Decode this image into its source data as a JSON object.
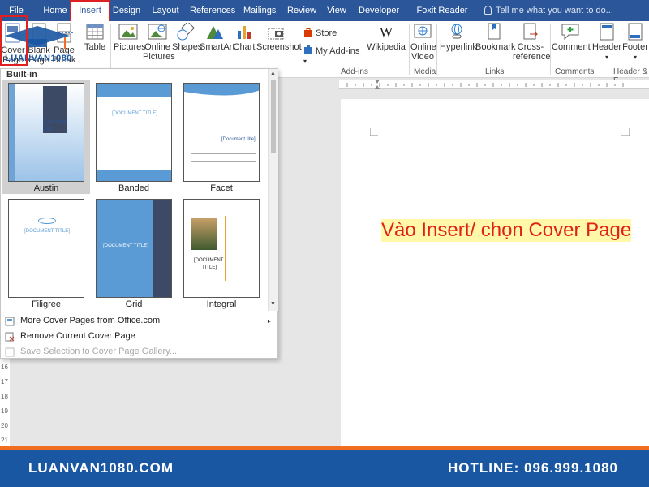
{
  "ribbon_tabs": [
    "File",
    "Home",
    "Insert",
    "Design",
    "Layout",
    "References",
    "Mailings",
    "Review",
    "View",
    "Developer",
    "Foxit Reader PDF"
  ],
  "tell_me": "Tell me what you want to do...",
  "colors": {
    "ribbon": "#2b579a",
    "highlight": "#e02020",
    "footer": "#1a57a2",
    "footer_stripe": "#f26d21",
    "caption_text": "#e0201a",
    "caption_bg": "#fff8a8"
  },
  "ribbon": {
    "pages_group": {
      "cover_page": "Cover Page",
      "blank_page": "Blank Page",
      "page_break": "Page Break"
    },
    "table": "Table",
    "pictures": "Pictures",
    "online_pictures": "Online Pictures",
    "shapes": "Shapes",
    "smartart": "SmartArt",
    "chart": "Chart",
    "screenshot": "Screenshot",
    "store": "Store",
    "my_addins": "My Add-ins",
    "wikipedia": "Wikipedia",
    "online_video": "Online Video",
    "hyperlink": "Hyperlink",
    "bookmark": "Bookmark",
    "cross_reference": "Cross-reference",
    "comment": "Comment",
    "header": "Header",
    "footer": "Footer",
    "groups": {
      "addins": "Add-ins",
      "media": "Media",
      "links": "Links",
      "comments": "Comments",
      "header_footer": "Header & F"
    }
  },
  "watermark": "LUANVAN1080",
  "gallery": {
    "heading": "Built-in",
    "templates": [
      {
        "name": "Austin",
        "selected": true
      },
      {
        "name": "Banded"
      },
      {
        "name": "Facet"
      },
      {
        "name": "Filigree"
      },
      {
        "name": "Grid"
      },
      {
        "name": "Integral"
      }
    ],
    "thumb_text": {
      "doc_title": "[Document title]",
      "doc_title_caps": "[DOCUMENT TITLE]",
      "doc_title_stack_1": "[DOCUMENT",
      "doc_title_stack_2": "TITLE]"
    },
    "menu": [
      {
        "label": "More Cover Pages from Office.com"
      },
      {
        "label": "Remove Current Cover Page"
      },
      {
        "label": "Save Selection to Cover Page Gallery...",
        "disabled": true
      }
    ]
  },
  "ruler_v_labels": [
    "16",
    "17",
    "18",
    "19",
    "20",
    "21"
  ],
  "caption": "Vào Insert/ chọn Cover Page",
  "footer": {
    "site": "LUANVAN1080.COM",
    "hotline": "HOTLINE: 096.999.1080"
  }
}
